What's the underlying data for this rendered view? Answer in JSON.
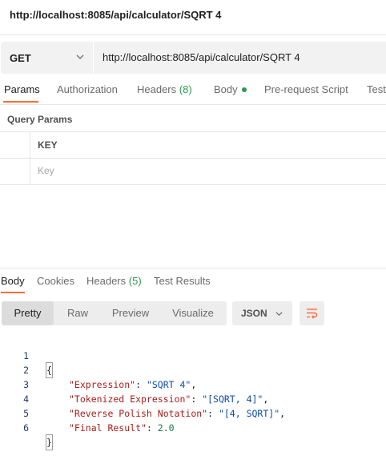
{
  "request": {
    "title": "http://localhost:8085/api/calculator/SQRT 4",
    "method": "GET",
    "url": "http://localhost:8085/api/calculator/SQRT 4"
  },
  "request_tabs": [
    {
      "label": "Params"
    },
    {
      "label": "Authorization"
    },
    {
      "label": "Headers",
      "count": "(8)"
    },
    {
      "label": "Body"
    },
    {
      "label": "Pre-request Script"
    },
    {
      "label": "Test"
    }
  ],
  "query_params": {
    "title": "Query Params",
    "key_header": "KEY",
    "key_placeholder": "Key"
  },
  "response_tabs": [
    {
      "label": "Body"
    },
    {
      "label": "Cookies"
    },
    {
      "label": "Headers",
      "count": "(5)"
    },
    {
      "label": "Test Results"
    }
  ],
  "response_toolbar": {
    "views": [
      "Pretty",
      "Raw",
      "Preview",
      "Visualize"
    ],
    "format": "JSON"
  },
  "response_body": {
    "line_numbers": [
      "1",
      "2",
      "3",
      "4",
      "5",
      "6"
    ],
    "open_brace": "{",
    "close_brace": "}",
    "fields": [
      {
        "key": "\"Expression\"",
        "value": "\"SQRT 4\"",
        "trail": ",",
        "type": "string"
      },
      {
        "key": "\"Tokenized Expression\"",
        "value": "\"[SQRT, 4]\"",
        "trail": ",",
        "type": "string"
      },
      {
        "key": "\"Reverse Polish Notation\"",
        "value": "\"[4, SQRT]\"",
        "trail": ",",
        "type": "string"
      },
      {
        "key": "\"Final Result\"",
        "value": "2.0",
        "trail": "",
        "type": "number"
      }
    ]
  },
  "colors": {
    "accent": "#ff6c37",
    "status_green": "#2b9a4b"
  }
}
